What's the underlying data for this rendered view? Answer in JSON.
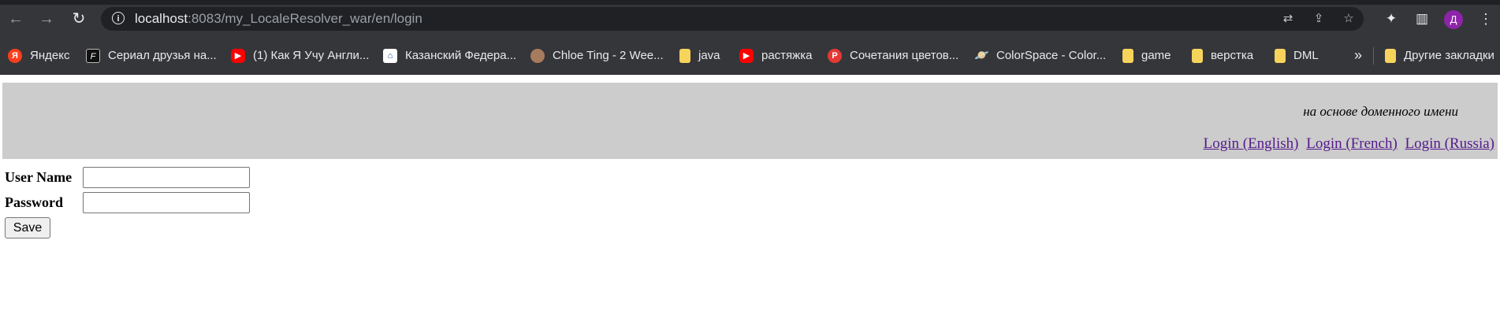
{
  "browser": {
    "url_host": "localhost",
    "url_path": ":8083/my_LocaleResolver_war/en/login",
    "profile_initial": "Д",
    "icons": [
      "back-icon",
      "forward-icon",
      "reload-icon",
      "info-icon",
      "translate-icon",
      "share-icon",
      "star-icon",
      "extensions-icon",
      "side-panel-icon",
      "menu-icon"
    ]
  },
  "bookmarks": {
    "items": [
      {
        "label": "Яндекс",
        "icon": "yandex-icon",
        "glyph": "Я"
      },
      {
        "label": "Сериал друзья на...",
        "icon": "f-icon",
        "glyph": "F"
      },
      {
        "label": "(1) Как Я Учу Англи...",
        "icon": "youtube-icon",
        "glyph": "▶"
      },
      {
        "label": "Казанский Федера...",
        "icon": "university-icon",
        "glyph": "🏛"
      },
      {
        "label": "Chloe Ting - 2 Wee...",
        "icon": "avatar-icon",
        "glyph": ""
      },
      {
        "label": "java",
        "icon": "folder-icon",
        "glyph": ""
      },
      {
        "label": "растяжка",
        "icon": "youtube-icon",
        "glyph": "▶"
      },
      {
        "label": "Сочетания цветов...",
        "icon": "p-icon",
        "glyph": "P"
      },
      {
        "label": "ColorSpace - Color...",
        "icon": "saturn-icon",
        "glyph": "🪐"
      },
      {
        "label": "game",
        "icon": "folder-icon",
        "glyph": ""
      },
      {
        "label": "верстка",
        "icon": "folder-icon",
        "glyph": ""
      },
      {
        "label": "DML",
        "icon": "folder-icon",
        "glyph": ""
      }
    ],
    "overflow": "»",
    "other": "Другие закладки"
  },
  "header": {
    "tagline": "на основе доменного имени",
    "links": [
      "Login (English)",
      "Login (French)",
      "Login (Russia)"
    ]
  },
  "form": {
    "username_label": "User Name",
    "password_label": "Password",
    "username_value": "",
    "password_value": "",
    "save_label": "Save"
  }
}
